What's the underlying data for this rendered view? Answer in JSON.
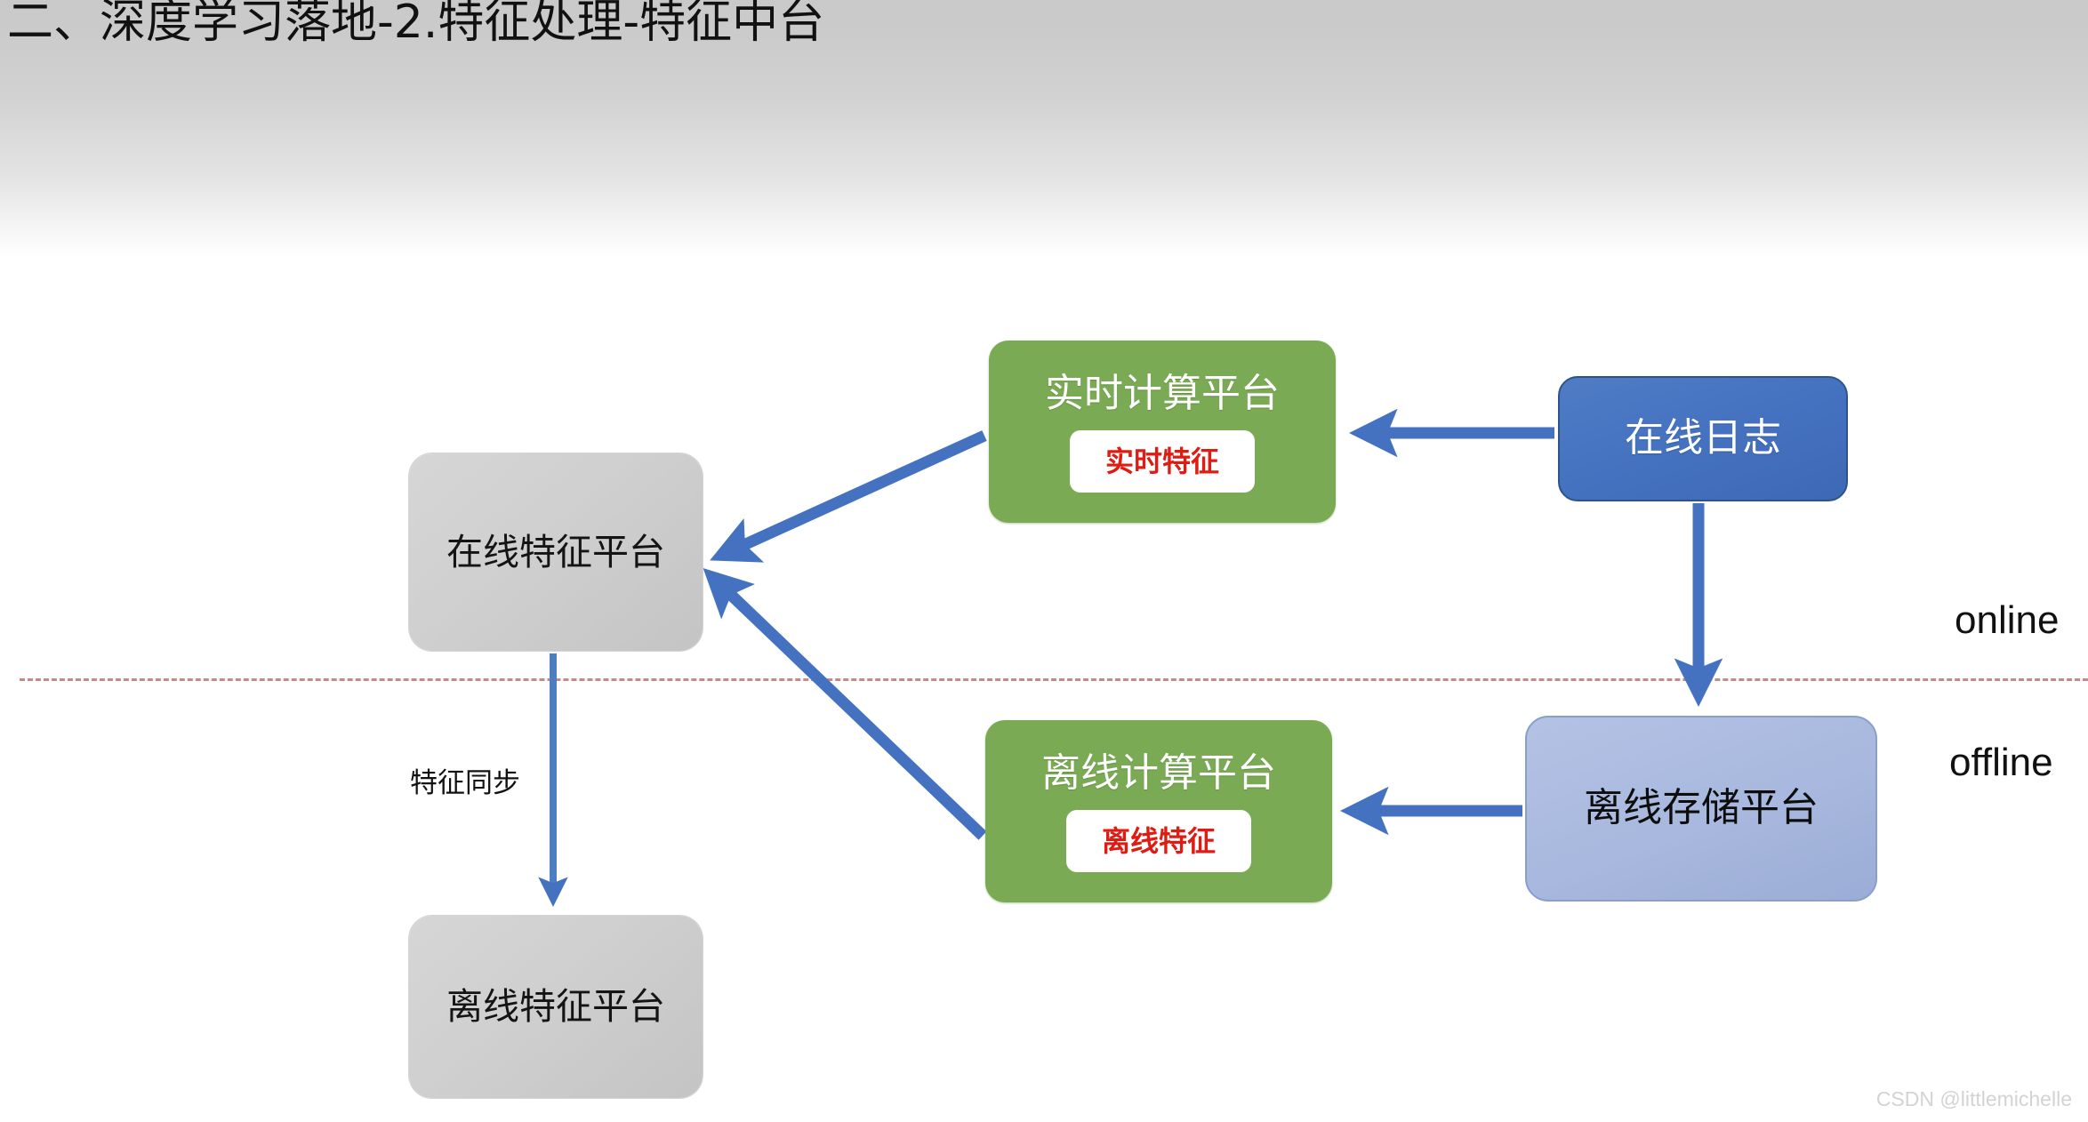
{
  "slide": {
    "title": "二、深度学习落地-2.特征处理-特征中台",
    "watermark": "CSDN @littlemichelle"
  },
  "diagram": {
    "nodes": {
      "online_feature_platform": {
        "label": "在线特征平台",
        "color": "#cfcfcf",
        "kind": "gray-box"
      },
      "offline_feature_platform": {
        "label": "离线特征平台",
        "color": "#cfcfcf",
        "kind": "gray-box"
      },
      "realtime_compute_platform": {
        "title": "实时计算平台",
        "chip": "实时特征",
        "color": "#7aab54",
        "chip_color": "#e01b12",
        "kind": "green-box"
      },
      "offline_compute_platform": {
        "title": "离线计算平台",
        "chip": "离线特征",
        "color": "#7aab54",
        "chip_color": "#e01b12",
        "kind": "green-box"
      },
      "online_log": {
        "label": "在线日志",
        "color": "#4572c0",
        "kind": "blue-dark-box"
      },
      "offline_storage_platform": {
        "label": "离线存储平台",
        "color": "#a8b8de",
        "kind": "blue-light-box"
      }
    },
    "edge_labels": {
      "feature_sync": "特征同步"
    },
    "zone_labels": {
      "online": "online",
      "offline": "offline"
    },
    "divider_color": "#c98a86",
    "arrow_color": "#4572c0"
  }
}
